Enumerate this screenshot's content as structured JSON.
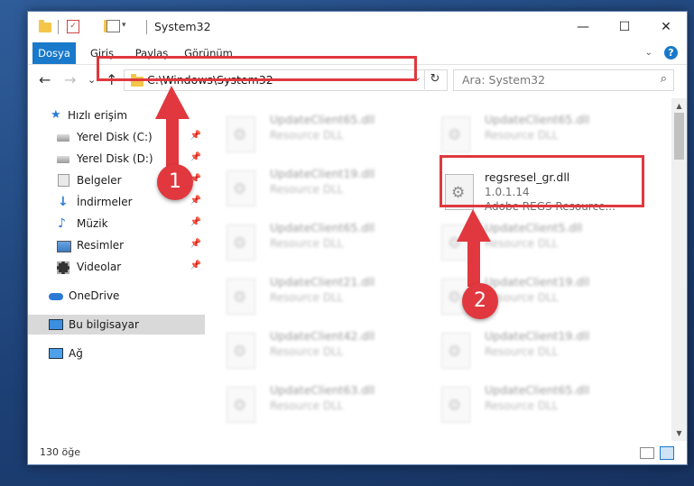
{
  "window": {
    "title": "System32",
    "controls": {
      "minimize": "—",
      "maximize": "☐",
      "close": "✕"
    }
  },
  "ribbon": {
    "tabs": [
      {
        "label": "Dosya",
        "active": true
      },
      {
        "label": "Giriş"
      },
      {
        "label": "Paylaş"
      },
      {
        "label": "Görünüm"
      }
    ],
    "help": "?"
  },
  "nav": {
    "back": "←",
    "forward": "→",
    "recent": "⌄",
    "up": "↑",
    "address": "C:\\Windows\\System32",
    "search_placeholder": "Ara: System32"
  },
  "sidebar": {
    "items": [
      {
        "label": "Hızlı erişim",
        "icon": "star-icon"
      },
      {
        "label": "Yerel Disk (C:)",
        "icon": "disk-icon",
        "pinned": true
      },
      {
        "label": "Yerel Disk (D:)",
        "icon": "disk-icon",
        "pinned": true
      },
      {
        "label": "Belgeler",
        "icon": "documents-icon",
        "pinned": true
      },
      {
        "label": "İndirmeler",
        "icon": "download-icon",
        "pinned": true
      },
      {
        "label": "Müzik",
        "icon": "music-icon",
        "pinned": true
      },
      {
        "label": "Resimler",
        "icon": "pictures-icon",
        "pinned": true
      },
      {
        "label": "Videolar",
        "icon": "videos-icon",
        "pinned": true
      },
      {
        "label": "OneDrive",
        "icon": "cloud-icon"
      },
      {
        "label": "Bu bilgisayar",
        "icon": "computer-icon",
        "selected": true
      },
      {
        "label": "Ağ",
        "icon": "network-icon"
      }
    ]
  },
  "files": [
    {
      "name": "UpdateClient65.dll",
      "type": "Resource DLL"
    },
    {
      "name": "UpdateClient65.dll",
      "type": "Resource DLL"
    },
    {
      "name": "UpdateClient19.dll",
      "type": "Resource DLL"
    },
    {
      "name": "regsresel_gr.dll",
      "version": "1.0.1.14",
      "description": "Adobe REGS Resource...",
      "highlighted": true
    },
    {
      "name": "UpdateClient65.dll",
      "type": "Resource DLL"
    },
    {
      "name": "UpdateClient5.dll",
      "type": "Resource DLL"
    },
    {
      "name": "UpdateClient21.dll",
      "type": "Resource DLL"
    },
    {
      "name": "UpdateClient19.dll",
      "type": "Resource DLL"
    },
    {
      "name": "UpdateClient42.dll",
      "type": "Resource DLL"
    },
    {
      "name": "UpdateClient19.dll",
      "type": "Resource DLL"
    },
    {
      "name": "UpdateClient63.dll",
      "type": "Resource DLL"
    },
    {
      "name": "UpdateClient65.dll",
      "type": "Resource DLL"
    }
  ],
  "status": {
    "item_count": "130 öğe"
  },
  "annotations": {
    "step1": "1",
    "step2": "2",
    "color": "#e0383e"
  },
  "colors": {
    "accent": "#1979ca",
    "highlight_box": "#e0383e"
  }
}
